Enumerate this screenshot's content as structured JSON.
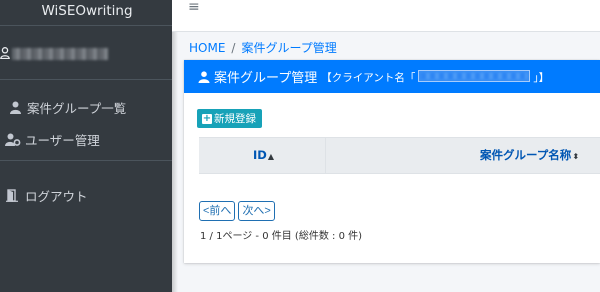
{
  "sidebar": {
    "brand": "WiSEOwriting",
    "user_name": "",
    "nav": [
      {
        "label": "案件グループ一覧",
        "icon": "users-icon"
      },
      {
        "label": "ユーザー管理",
        "icon": "user-cog-icon"
      },
      {
        "label": "ログアウト",
        "icon": "door-open-icon"
      }
    ]
  },
  "topbar": {
    "menu_icon": "≡"
  },
  "breadcrumb": {
    "home": "HOME",
    "separator": "/",
    "current": "案件グループ管理"
  },
  "card": {
    "title": "案件グループ管理",
    "client_prefix": "【クライアント名「",
    "client_suffix": "」】",
    "new_button": "新規登録",
    "table": {
      "columns": [
        {
          "label": "ID",
          "sort": "▲"
        },
        {
          "label": "案件グループ名称",
          "sort": "⬍"
        }
      ],
      "rows": []
    },
    "pagination": {
      "prev": "<前へ",
      "next": "次へ>",
      "info": "1 / 1ページ - 0 件目 (総件数 : 0 件)"
    }
  },
  "colors": {
    "sidebar": "#343a40",
    "header": "#007bff",
    "accent": "#17a2b8",
    "link": "#0056b3"
  }
}
